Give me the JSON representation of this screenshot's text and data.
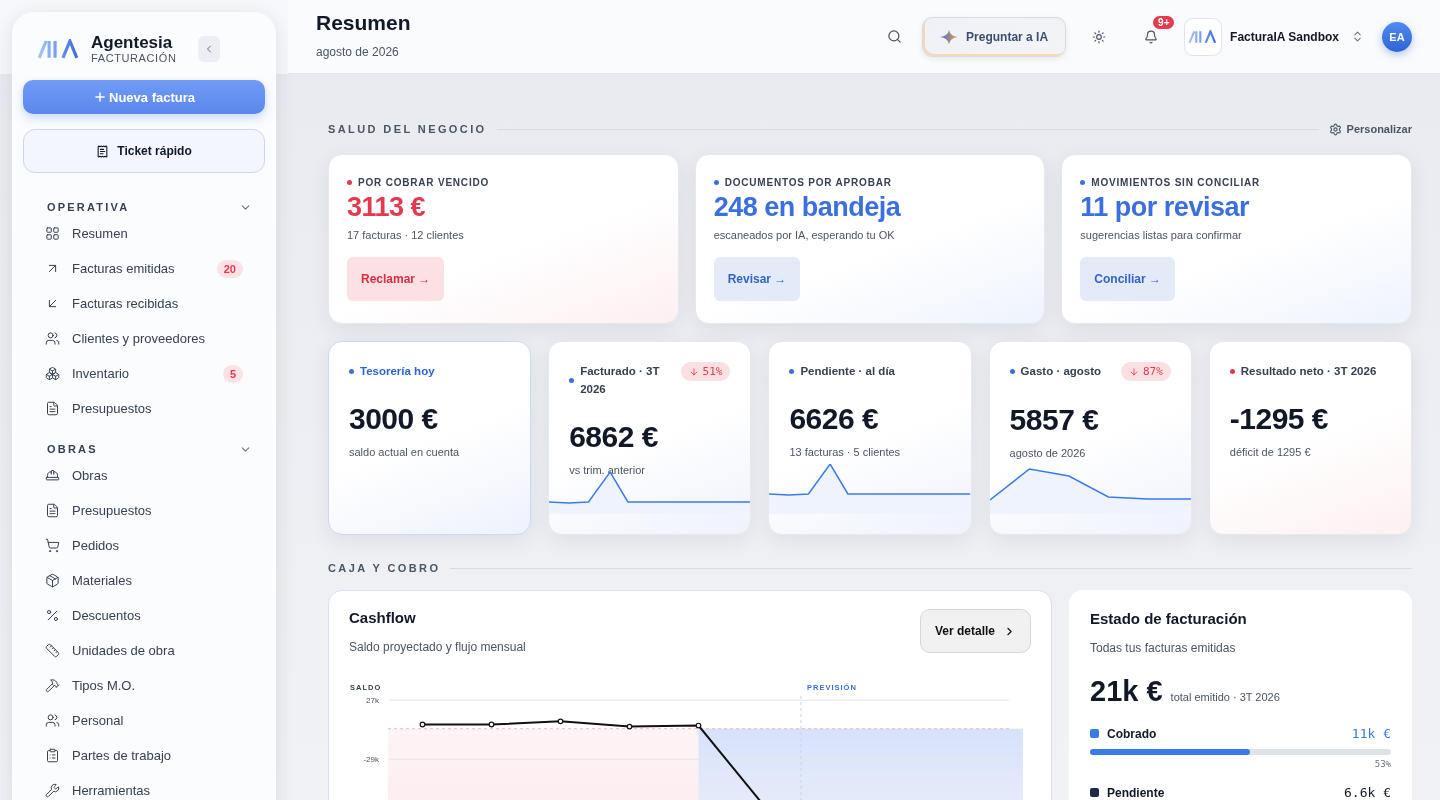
{
  "sidebar": {
    "brand": {
      "name": "Agentesia",
      "sub": "FACTURACIÓN"
    },
    "primary_button": "Nueva factura",
    "secondary_button": "Ticket rápido",
    "sections": [
      {
        "title": "OPERATIVA",
        "expanded": true,
        "items": [
          {
            "label": "Resumen"
          },
          {
            "label": "Facturas emitidas",
            "badge": "20"
          },
          {
            "label": "Facturas recibidas"
          },
          {
            "label": "Clientes y proveedores"
          },
          {
            "label": "Inventario",
            "badge": "5"
          },
          {
            "label": "Presupuestos"
          }
        ]
      },
      {
        "title": "OBRAS",
        "expanded": true,
        "items": [
          {
            "label": "Obras"
          },
          {
            "label": "Presupuestos"
          },
          {
            "label": "Pedidos"
          },
          {
            "label": "Materiales"
          },
          {
            "label": "Descuentos"
          },
          {
            "label": "Unidades de obra"
          },
          {
            "label": "Tipos M.O."
          },
          {
            "label": "Personal"
          },
          {
            "label": "Partes de trabajo"
          },
          {
            "label": "Herramientas"
          }
        ]
      }
    ]
  },
  "header": {
    "title": "Resumen",
    "subtitle": "agosto de 2026",
    "ask_ai": "Preguntar a IA",
    "notifications": "9+",
    "workspace": "FacturaIA Sandbox",
    "avatar": "EA"
  },
  "health": {
    "title": "SALUD DEL NEGOCIO",
    "action": "Personalizar",
    "cards": [
      {
        "label": "POR COBRAR VENCIDO",
        "color": "#e5394f",
        "value": "3113 €",
        "caption": "17 facturas · 12 clientes",
        "button": "Reclamar →"
      },
      {
        "label": "DOCUMENTOS POR APROBAR",
        "color": "#3b6fe0",
        "value": "248 en bandeja",
        "caption": "escaneados por IA, esperando tu OK",
        "button": "Revisar →"
      },
      {
        "label": "MOVIMIENTOS SIN CONCILIAR",
        "color": "#3b6fe0",
        "value": "11 por revisar",
        "caption": "sugerencias listas para confirmar",
        "button": "Conciliar →"
      }
    ]
  },
  "kpis": [
    {
      "kind": "plain",
      "highlighted": true,
      "color": "#3b6fe0",
      "label": "Tesorería hoy",
      "value": "3000 €",
      "caption": "saldo actual en cuenta"
    },
    {
      "kind": "sparkline",
      "highlighted": false,
      "color": "#3b6fe0",
      "label": "Facturado · 3T 2026",
      "change": "51%",
      "value": "6862 €",
      "caption": "vs trim. anterior"
    },
    {
      "kind": "sparkline",
      "highlighted": false,
      "color": "#3b6fe0",
      "label": "Pendiente · al día",
      "value": "6626 €",
      "caption": "13 facturas · 5 clientes"
    },
    {
      "kind": "sparkline",
      "highlighted": false,
      "color": "#3b6fe0",
      "label": "Gasto · agosto",
      "change": "87%",
      "value": "5857 €",
      "caption": "agosto de 2026"
    },
    {
      "kind": "plain",
      "highlighted": false,
      "color": "#e5394f",
      "label": "Resultado neto · 3T 2026",
      "value": "-1295 €",
      "caption": "déficit de 1295 €"
    }
  ],
  "cash_section": {
    "title": "CAJA Y COBRO"
  },
  "cashflow": {
    "title": "Cashflow",
    "subtitle": "Saldo proyectado y flujo mensual",
    "button": "Ver detalle",
    "chart_data": {
      "type": "line",
      "ylabel": "SALDO",
      "categories": [
        null,
        null,
        null,
        null,
        null,
        null,
        null,
        null,
        null
      ],
      "grid": true,
      "ref_lines": [
        {
          "axis": "y",
          "value": 0
        }
      ],
      "ylim": [
        -77000,
        31000
      ],
      "yticks": [
        {
          "value": 27000,
          "label": "27k"
        },
        {
          "value": -29000,
          "label": "-29k"
        }
      ],
      "series": [
        {
          "color": "#111111",
          "marker": "o",
          "values": [
            4000,
            4000,
            7000,
            2000,
            3000,
            -77000,
            null,
            null,
            null
          ]
        }
      ],
      "annotations": [
        "PREVISIÓN"
      ]
    }
  },
  "billing": {
    "title": "Estado de facturación",
    "subtitle": "Todas tus facturas emitidas",
    "total": "21k €",
    "total_caption": "total emitido · 3T 2026",
    "rows": [
      {
        "label": "Cobrado",
        "color": "#3b7be8",
        "amount": "11k €",
        "level": 0.53,
        "percent": "53%"
      },
      {
        "label": "Pendiente",
        "color": "#1e2a44",
        "amount": "6.6k €"
      }
    ]
  }
}
